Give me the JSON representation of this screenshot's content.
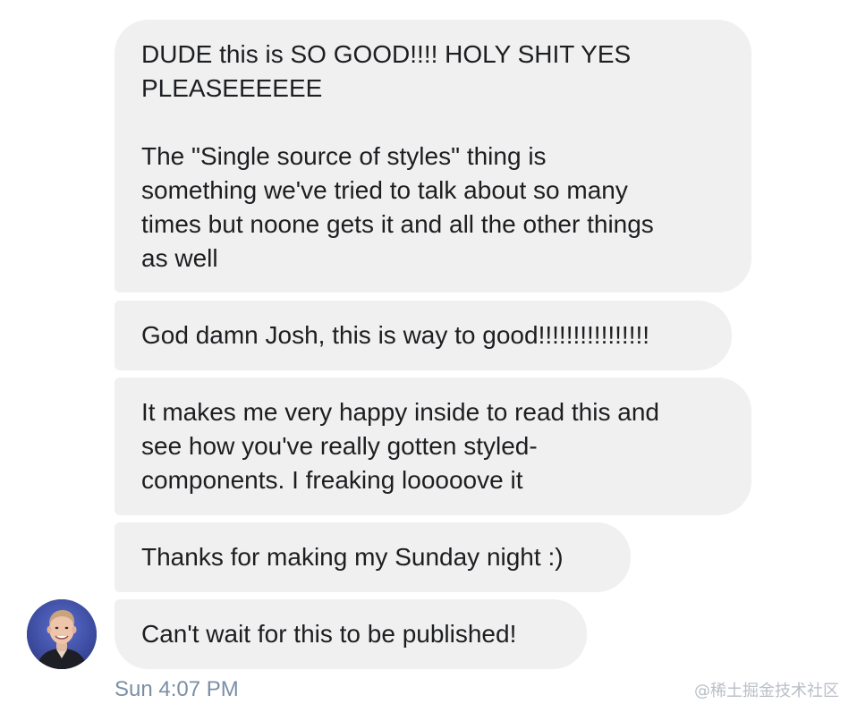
{
  "messages": [
    "DUDE this is SO GOOD!!!! HOLY SHIT YES\nPLEASEEEEEE\n\nThe \"Single source of styles\" thing is\nsomething we've tried to talk about so many\ntimes but noone gets it and all the other things\nas well",
    "God damn Josh, this is way to good!!!!!!!!!!!!!!!!",
    "It makes me very happy inside to read this and\nsee how you've really gotten styled-\ncomponents. I freaking looooove it",
    "Thanks for making my Sunday night :)",
    "Can't wait for this to be published!"
  ],
  "timestamp": "Sun 4:07 PM",
  "watermark": "@稀土掘金技术社区",
  "colors": {
    "bubble": "#f1f0f0",
    "timestamp": "#7a8fa6",
    "avatar_bg": "#3b4a9a"
  },
  "avatar_icon": "person-avatar"
}
